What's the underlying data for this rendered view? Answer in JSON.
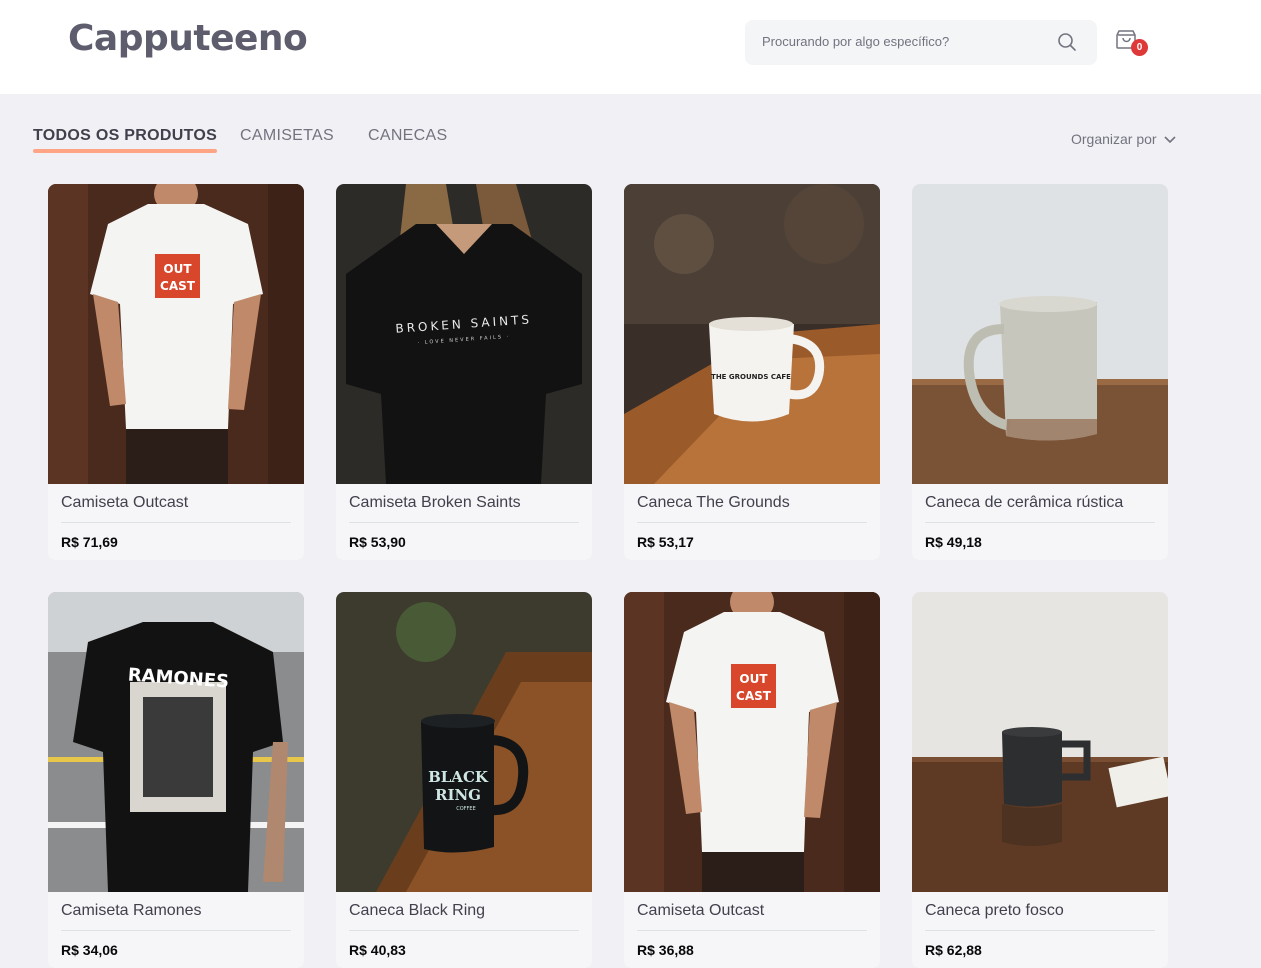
{
  "header": {
    "logo": "Capputeeno",
    "search_placeholder": "Procurando por algo específico?",
    "cart_count": "0"
  },
  "tabs": [
    {
      "label": "TODOS OS PRODUTOS",
      "active": true
    },
    {
      "label": "CAMISETAS",
      "active": false
    },
    {
      "label": "CANECAS",
      "active": false
    }
  ],
  "sort_label": "Organizar por",
  "products": [
    {
      "name": "Camiseta Outcast",
      "price": "R$ 71,69",
      "image": "white-tshirt-outcast-print"
    },
    {
      "name": "Camiseta Broken Saints",
      "price": "R$ 53,90",
      "image": "black-tshirt-broken-saints"
    },
    {
      "name": "Caneca The Grounds",
      "price": "R$ 53,17",
      "image": "white-mug-the-grounds-cafe"
    },
    {
      "name": "Caneca de cerâmica rústica",
      "price": "R$ 49,18",
      "image": "rustic-ceramic-mug"
    },
    {
      "name": "Camiseta Ramones",
      "price": "R$ 34,06",
      "image": "black-tshirt-ramones"
    },
    {
      "name": "Caneca Black Ring",
      "price": "R$ 40,83",
      "image": "black-mug-black-ring-coffee"
    },
    {
      "name": "Camiseta Outcast",
      "price": "R$ 36,88",
      "image": "white-tshirt-outcast-print"
    },
    {
      "name": "Caneca preto fosco",
      "price": "R$ 62,88",
      "image": "matte-black-mug"
    }
  ],
  "image_text": {
    "outcast": "OUT CAST",
    "broken_saints": "BROKEN SAINTS",
    "broken_saints_sub": "· LOVE NEVER FAILS ·",
    "grounds": "THE GROUNDS CAFE",
    "ramones": "RAMONES",
    "black_ring": "BLACK RING",
    "black_ring_sub": "COFFEE"
  }
}
